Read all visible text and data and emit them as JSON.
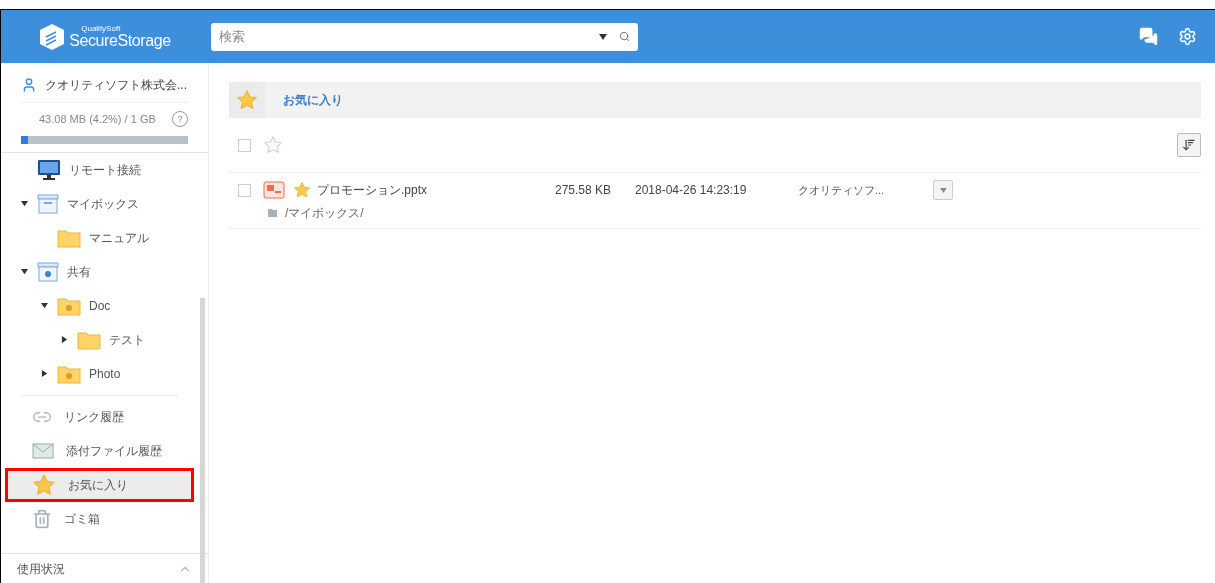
{
  "logo": {
    "brand": "QualitySoft",
    "name_a": "Secure",
    "name_b": "Storage"
  },
  "search": {
    "placeholder": "検索"
  },
  "account": {
    "name": "クオリティソフト株式会...",
    "usage": "43.08 MB (4.2%) / 1 GB",
    "help": "?",
    "level": 0.042
  },
  "tree": [
    {
      "label": "リモート接続",
      "kind": "remote"
    },
    {
      "label": "マイボックス",
      "kind": "box",
      "expanded": true,
      "children": [
        {
          "label": "マニュアル",
          "kind": "folder"
        }
      ]
    },
    {
      "label": "共有",
      "kind": "shared-box",
      "expanded": true,
      "children": [
        {
          "label": "Doc",
          "kind": "shared-folder",
          "expanded": true,
          "children": [
            {
              "label": "テスト",
              "kind": "folder",
              "expanded": false
            }
          ]
        },
        {
          "label": "Photo",
          "kind": "shared-folder",
          "expanded": false
        }
      ]
    }
  ],
  "nav": [
    {
      "label": "リンク履歴",
      "kind": "link",
      "selected": false
    },
    {
      "label": "添付ファイル履歴",
      "kind": "mail",
      "selected": false
    },
    {
      "label": "お気に入り",
      "kind": "star",
      "selected": true
    },
    {
      "label": "ゴミ箱",
      "kind": "trash",
      "selected": false
    }
  ],
  "footer": {
    "label": "使用状況",
    "expanded": true
  },
  "main": {
    "title": "お気に入り",
    "select_all": {
      "checked": false
    },
    "files": [
      {
        "name": "プロモーション.pptx",
        "size": "275.58 KB",
        "date": "2018-04-26 14:23:19",
        "owner": "クオリティソフ...",
        "path": "/マイボックス/",
        "starred": true,
        "checked": false
      }
    ]
  }
}
